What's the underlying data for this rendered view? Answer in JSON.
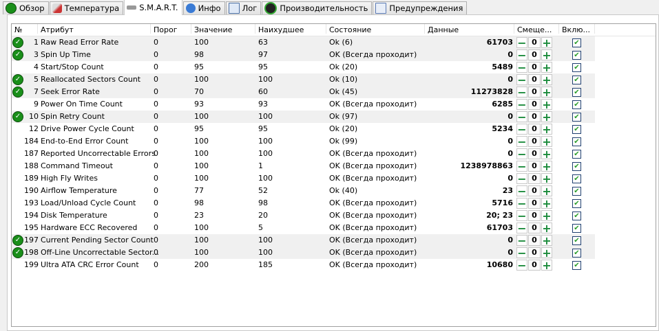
{
  "tabs": [
    {
      "label": "Обзор",
      "icon": "check-circle-icon"
    },
    {
      "label": "Температура",
      "icon": "thermometer-icon"
    },
    {
      "label": "S.M.A.R.T.",
      "icon": "drive-icon",
      "active": true
    },
    {
      "label": "Инфо",
      "icon": "info-icon"
    },
    {
      "label": "Лог",
      "icon": "document-icon"
    },
    {
      "label": "Производительность",
      "icon": "gauge-icon"
    },
    {
      "label": "Предупреждения",
      "icon": "pages-icon"
    }
  ],
  "columns": [
    "№",
    "Атрибут",
    "Порог",
    "Значение",
    "Наихудшее",
    "Состояние",
    "Данные",
    "Смеще...",
    "Вклю..."
  ],
  "rows": [
    {
      "id": "1",
      "name": "Raw Read Error Rate",
      "thr": "0",
      "val": "100",
      "worst": "63",
      "state": "Ok (6)",
      "data": "61703",
      "off": "0",
      "ok": true
    },
    {
      "id": "3",
      "name": "Spin Up Time",
      "thr": "0",
      "val": "98",
      "worst": "97",
      "state": "OK (Всегда проходит)",
      "data": "0",
      "off": "0",
      "ok": true
    },
    {
      "id": "4",
      "name": "Start/Stop Count",
      "thr": "0",
      "val": "95",
      "worst": "95",
      "state": "Ok (20)",
      "data": "5489",
      "off": "0",
      "ok": false
    },
    {
      "id": "5",
      "name": "Reallocated Sectors Count",
      "thr": "0",
      "val": "100",
      "worst": "100",
      "state": "Ok (10)",
      "data": "0",
      "off": "0",
      "ok": true
    },
    {
      "id": "7",
      "name": "Seek Error Rate",
      "thr": "0",
      "val": "70",
      "worst": "60",
      "state": "Ok (45)",
      "data": "11273828",
      "off": "0",
      "ok": true
    },
    {
      "id": "9",
      "name": "Power On Time Count",
      "thr": "0",
      "val": "93",
      "worst": "93",
      "state": "OK (Всегда проходит)",
      "data": "6285",
      "off": "0",
      "ok": false
    },
    {
      "id": "10",
      "name": "Spin Retry Count",
      "thr": "0",
      "val": "100",
      "worst": "100",
      "state": "Ok (97)",
      "data": "0",
      "off": "0",
      "ok": true
    },
    {
      "id": "12",
      "name": "Drive Power Cycle Count",
      "thr": "0",
      "val": "95",
      "worst": "95",
      "state": "Ok (20)",
      "data": "5234",
      "off": "0",
      "ok": false
    },
    {
      "id": "184",
      "name": "End-to-End Error Count",
      "thr": "0",
      "val": "100",
      "worst": "100",
      "state": "Ok (99)",
      "data": "0",
      "off": "0",
      "ok": false
    },
    {
      "id": "187",
      "name": "Reported Uncorrectable Errors",
      "thr": "0",
      "val": "100",
      "worst": "100",
      "state": "OK (Всегда проходит)",
      "data": "0",
      "off": "0",
      "ok": false
    },
    {
      "id": "188",
      "name": "Command Timeout",
      "thr": "0",
      "val": "100",
      "worst": "1",
      "state": "OK (Всегда проходит)",
      "data": "1238978863",
      "off": "0",
      "ok": false
    },
    {
      "id": "189",
      "name": "High Fly Writes",
      "thr": "0",
      "val": "100",
      "worst": "100",
      "state": "OK (Всегда проходит)",
      "data": "0",
      "off": "0",
      "ok": false
    },
    {
      "id": "190",
      "name": "Airflow Temperature",
      "thr": "0",
      "val": "77",
      "worst": "52",
      "state": "Ok (40)",
      "data": "23",
      "off": "0",
      "ok": false
    },
    {
      "id": "193",
      "name": "Load/Unload Cycle Count",
      "thr": "0",
      "val": "98",
      "worst": "98",
      "state": "OK (Всегда проходит)",
      "data": "5716",
      "off": "0",
      "ok": false
    },
    {
      "id": "194",
      "name": "Disk Temperature",
      "thr": "0",
      "val": "23",
      "worst": "20",
      "state": "OK (Всегда проходит)",
      "data": "20; 23",
      "off": "0",
      "ok": false
    },
    {
      "id": "195",
      "name": "Hardware ECC Recovered",
      "thr": "0",
      "val": "100",
      "worst": "5",
      "state": "OK (Всегда проходит)",
      "data": "61703",
      "off": "0",
      "ok": false
    },
    {
      "id": "197",
      "name": "Current Pending Sector Count",
      "thr": "0",
      "val": "100",
      "worst": "100",
      "state": "OK (Всегда проходит)",
      "data": "0",
      "off": "0",
      "ok": true
    },
    {
      "id": "198",
      "name": "Off-Line Uncorrectable Sector...",
      "thr": "0",
      "val": "100",
      "worst": "100",
      "state": "OK (Всегда проходит)",
      "data": "0",
      "off": "0",
      "ok": true
    },
    {
      "id": "199",
      "name": "Ultra ATA CRC Error Count",
      "thr": "0",
      "val": "200",
      "worst": "185",
      "state": "OK (Всегда проходит)",
      "data": "10680",
      "off": "0",
      "ok": false
    }
  ],
  "colors": {
    "ok": "#1a8f1a",
    "plus_minus": "#1a8a3a",
    "row_shade": "#f0f0f0"
  }
}
